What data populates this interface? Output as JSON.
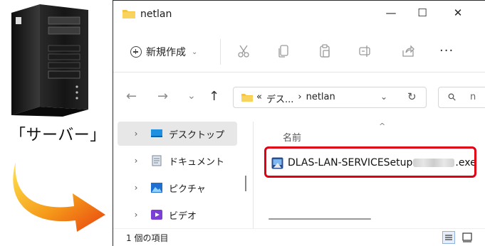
{
  "illustration": {
    "caption": "「サーバー」"
  },
  "window": {
    "title": "netlan",
    "controls": {
      "minimize": "—",
      "maximize": "☐",
      "close": "✕"
    },
    "toolbar": {
      "new_label": "新規作成",
      "icons": [
        "cut-icon",
        "copy-icon",
        "paste-icon",
        "rename-icon",
        "share-icon"
      ],
      "more": "···"
    },
    "address": {
      "back": "←",
      "forward": "→",
      "recent": "⌄",
      "up": "↑",
      "overflow": "«",
      "segments": [
        "デス...",
        "›",
        "netlan"
      ],
      "dropdown": "⌄",
      "refresh": "↻",
      "search_placeholder": "n"
    },
    "nav": {
      "items": [
        {
          "label": "デスクトップ",
          "icon": "desktop-icon"
        },
        {
          "label": "ドキュメント",
          "icon": "documents-icon"
        },
        {
          "label": "ピクチャ",
          "icon": "pictures-icon"
        },
        {
          "label": "ビデオ",
          "icon": "videos-icon"
        }
      ]
    },
    "content": {
      "column_name": "名前",
      "sort_indicator": "^",
      "file_prefix": "DLAS-LAN-SERVICESetup",
      "file_suffix": ".exe"
    },
    "status": {
      "item_count": "1 個の項目"
    },
    "colors": {
      "highlight_border": "#e10013",
      "folder": "#f5c542",
      "accent": "#0067c0"
    }
  }
}
